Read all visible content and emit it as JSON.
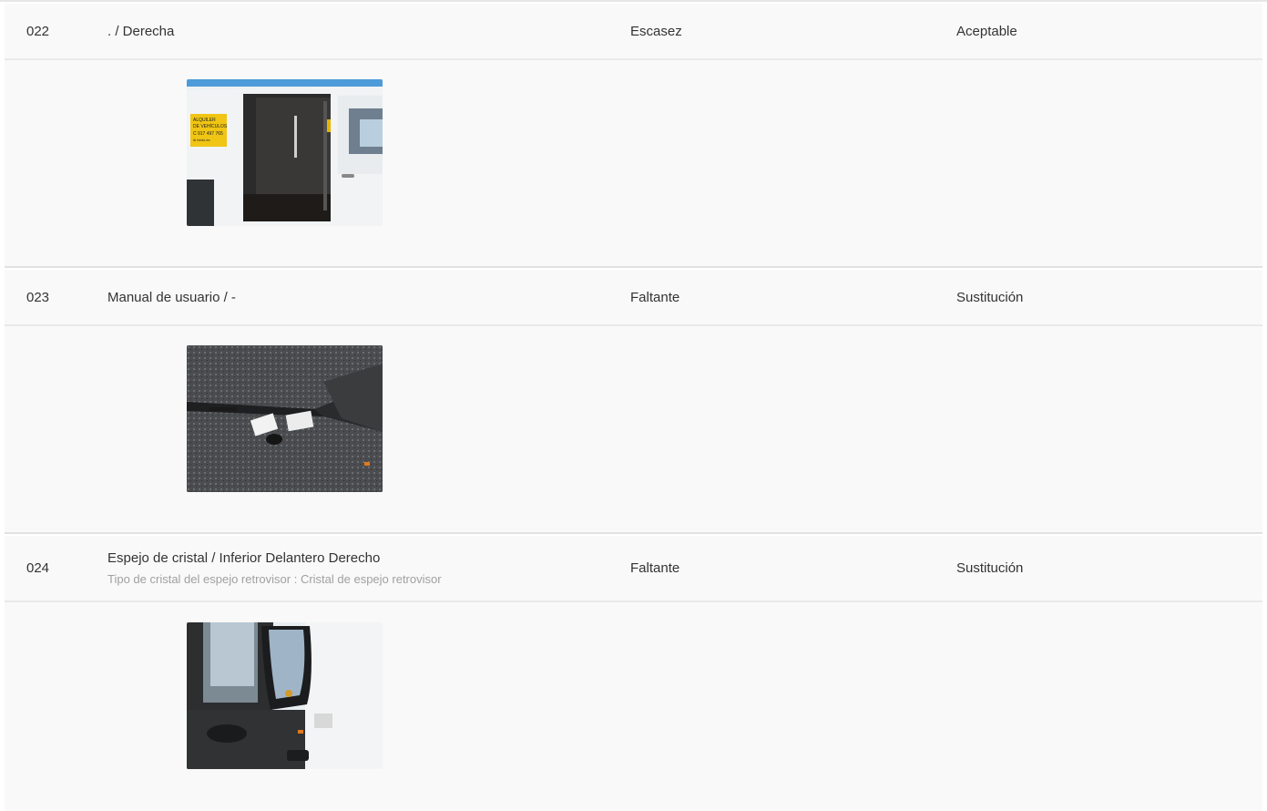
{
  "items": [
    {
      "number": "022",
      "description": ". / Derecha",
      "detail": "",
      "state": "Escasez",
      "action": "Aceptable",
      "photo_icon": "van-side-door-photo"
    },
    {
      "number": "023",
      "description": "Manual de usuario / -",
      "detail": "",
      "state": "Faltante",
      "action": "Sustitución",
      "photo_icon": "van-seat-photo"
    },
    {
      "number": "024",
      "description": "Espejo de cristal / Inferior Delantero Derecho",
      "detail": "Tipo de cristal del espejo retrovisor : Cristal de espejo retrovisor",
      "state": "Faltante",
      "action": "Sustitución",
      "photo_icon": "side-mirror-photo"
    }
  ],
  "photo_sign": {
    "line1": "ALQUILER",
    "line2": "DE VEHÍCULOS",
    "line3": "C 917 497 765",
    "line4": "ib hertz.es"
  }
}
